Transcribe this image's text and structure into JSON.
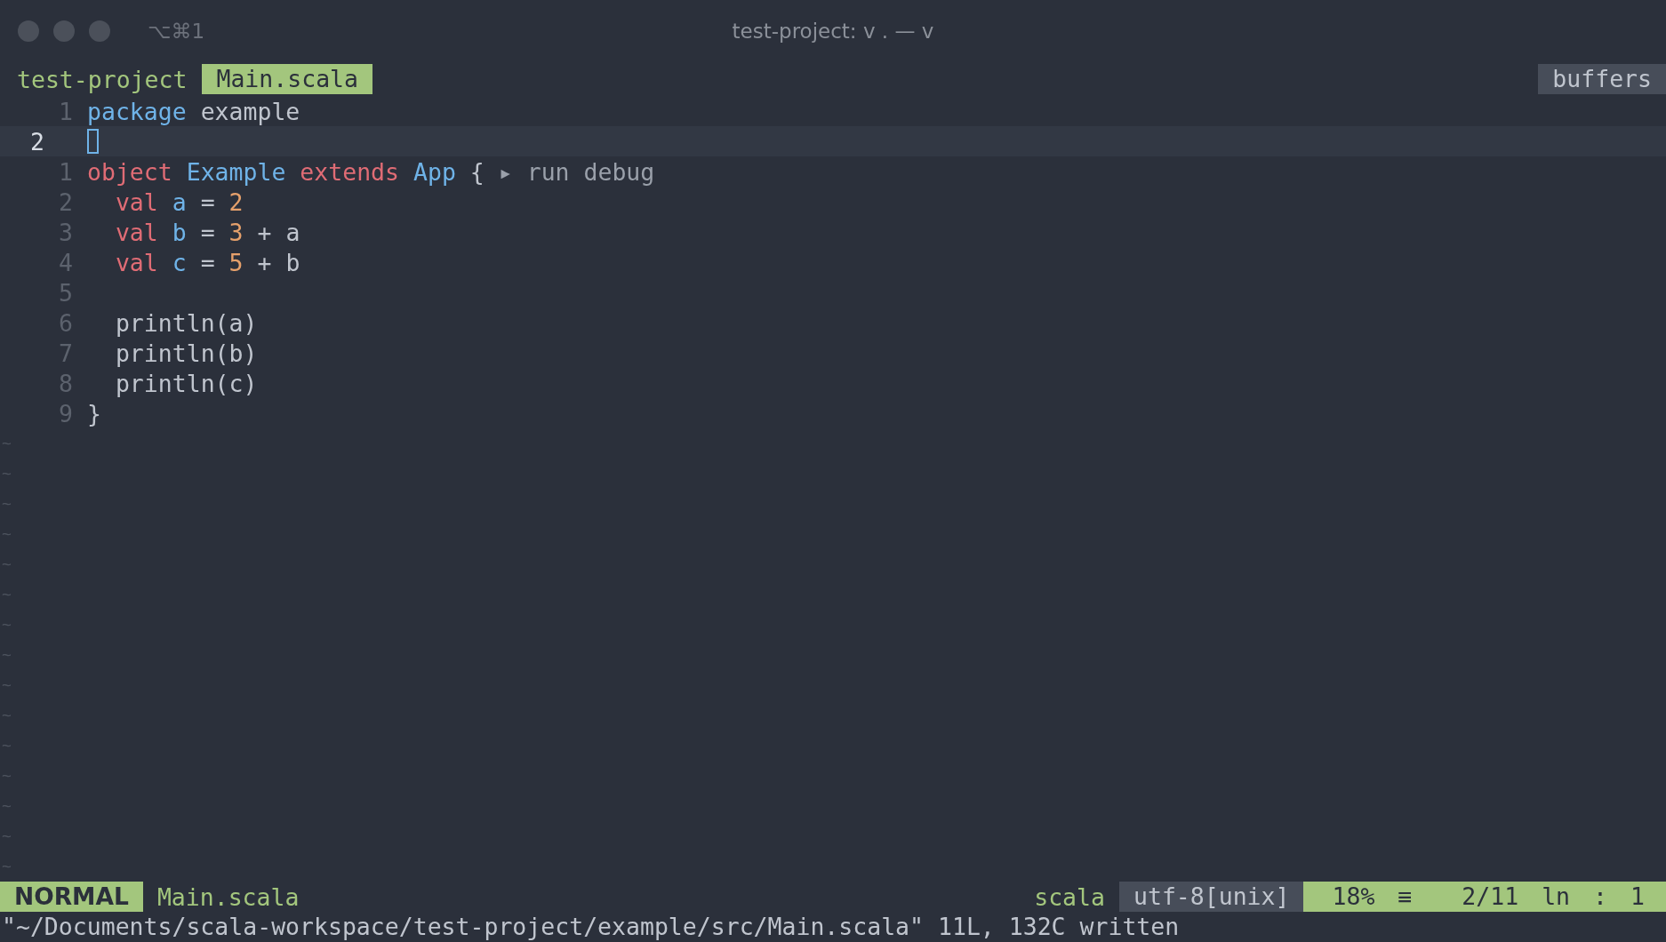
{
  "window": {
    "title": "test-project: v . — v",
    "shortcut": "⌥⌘1"
  },
  "tabline": {
    "project": "test-project",
    "tabs": [
      {
        "label": "Main.scala",
        "selected": true
      }
    ],
    "buffers": "buffers"
  },
  "lines": [
    {
      "number": "1",
      "current": false,
      "cursor": false,
      "tokens": [
        {
          "text": "package",
          "kind": "type"
        },
        {
          "text": " example",
          "kind": "plain"
        }
      ]
    },
    {
      "number": "2",
      "current": true,
      "cursor": true
    },
    {
      "number": "1",
      "current": false,
      "cursor": false,
      "tokens": [
        {
          "text": "object",
          "kind": "keyword"
        },
        {
          "text": " Example",
          "kind": "type"
        },
        {
          "text": " extends",
          "kind": "keyword"
        },
        {
          "text": " App",
          "kind": "type"
        },
        {
          "text": " {",
          "kind": "plain"
        }
      ],
      "codelens": "▸ run debug"
    },
    {
      "number": "2",
      "current": false,
      "cursor": false,
      "tokens": [
        {
          "text": "  val",
          "kind": "keyword"
        },
        {
          "text": " a",
          "kind": "type"
        },
        {
          "text": " = ",
          "kind": "plain"
        },
        {
          "text": "2",
          "kind": "number"
        }
      ]
    },
    {
      "number": "3",
      "current": false,
      "cursor": false,
      "tokens": [
        {
          "text": "  val",
          "kind": "keyword"
        },
        {
          "text": " b",
          "kind": "type"
        },
        {
          "text": " = ",
          "kind": "plain"
        },
        {
          "text": "3",
          "kind": "number"
        },
        {
          "text": " + a",
          "kind": "plain"
        }
      ]
    },
    {
      "number": "4",
      "current": false,
      "cursor": false,
      "tokens": [
        {
          "text": "  val",
          "kind": "keyword"
        },
        {
          "text": " c",
          "kind": "type"
        },
        {
          "text": " = ",
          "kind": "plain"
        },
        {
          "text": "5",
          "kind": "number"
        },
        {
          "text": " + b",
          "kind": "plain"
        }
      ]
    },
    {
      "number": "5",
      "current": false,
      "cursor": false
    },
    {
      "number": "6",
      "current": false,
      "cursor": false,
      "tokens": [
        {
          "text": "  println(a)",
          "kind": "plain"
        }
      ]
    },
    {
      "number": "7",
      "current": false,
      "cursor": false,
      "tokens": [
        {
          "text": "  println(b)",
          "kind": "plain"
        }
      ]
    },
    {
      "number": "8",
      "current": false,
      "cursor": false,
      "tokens": [
        {
          "text": "  println(c)",
          "kind": "plain"
        }
      ]
    },
    {
      "number": "9",
      "current": false,
      "cursor": false,
      "tokens": [
        {
          "text": "}",
          "kind": "plain"
        }
      ]
    }
  ],
  "empty_lines": [
    "~",
    "~",
    "~",
    "~",
    "~",
    "~",
    "~",
    "~",
    "~",
    "~",
    "~",
    "~",
    "~",
    "~",
    "~"
  ],
  "status_bar": {
    "mode": "NORMAL",
    "file": "Main.scala",
    "filetype": "scala",
    "encoding": "utf-8[unix]",
    "percent": "18%",
    "menu": "≡",
    "position": "2/11",
    "ln": "ln",
    "colon": ":",
    "column": "1"
  },
  "message": "\"~/Documents/scala-workspace/test-project/example/src/Main.scala\" 11L, 132C written"
}
